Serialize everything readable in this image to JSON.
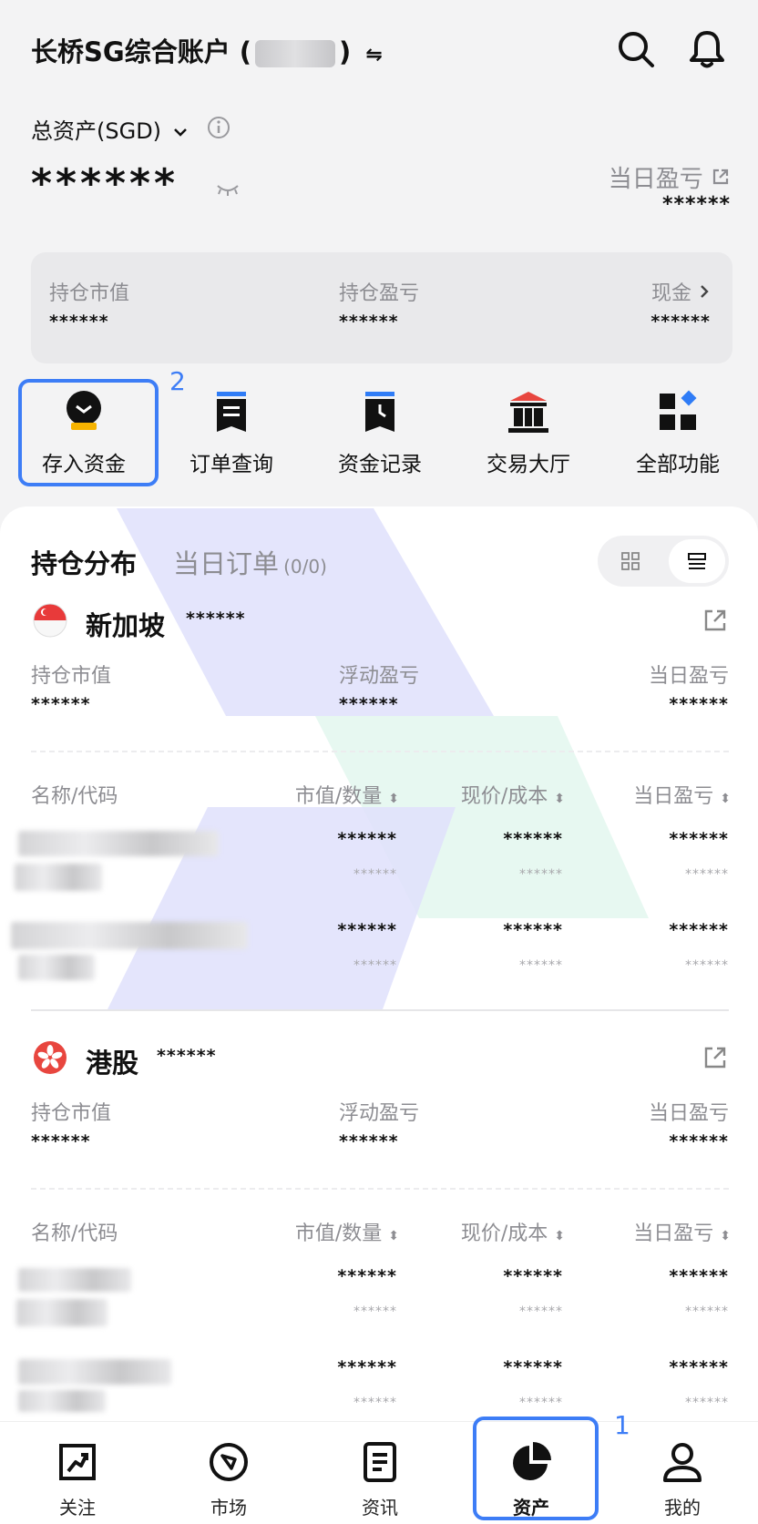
{
  "header": {
    "title_prefix": "长桥SG综合账户 (",
    "title_suffix": ")",
    "swap_glyph": "⇋",
    "search_icon": "search-icon",
    "bell_icon": "bell-icon"
  },
  "summary": {
    "total_assets_label": "总资产(SGD)",
    "total_assets_value": "******",
    "daily_pl_label": "当日盈亏",
    "daily_pl_value": "******"
  },
  "asset_card": {
    "market_value_label": "持仓市值",
    "market_value": "******",
    "position_pl_label": "持仓盈亏",
    "position_pl": "******",
    "cash_label": "现金",
    "cash_value": "******"
  },
  "quick_actions": [
    {
      "label": "存入资金",
      "icon": "deposit-icon"
    },
    {
      "label": "订单查询",
      "icon": "order-query-icon"
    },
    {
      "label": "资金记录",
      "icon": "fund-record-icon"
    },
    {
      "label": "交易大厅",
      "icon": "trading-hall-icon"
    },
    {
      "label": "全部功能",
      "icon": "all-functions-icon"
    }
  ],
  "positions": {
    "tab_holdings": "持仓分布",
    "tab_orders": "当日订单",
    "tab_orders_count": "(0/0)",
    "markets": [
      {
        "name": "新加坡",
        "total": "******",
        "labels": {
          "market_value": "持仓市值",
          "floating_pl": "浮动盈亏",
          "daily_pl": "当日盈亏"
        },
        "values": {
          "market_value": "******",
          "floating_pl": "******",
          "daily_pl": "******"
        },
        "table_headers": {
          "name": "名称/代码",
          "value_qty": "市值/数量",
          "price_cost": "现价/成本",
          "daily_pl": "当日盈亏"
        },
        "rows": [
          {
            "v1": "******",
            "v2": "******",
            "v3": "******",
            "s1": "******",
            "s2": "******",
            "s3": "******"
          },
          {
            "v1": "******",
            "v2": "******",
            "v3": "******",
            "s1": "******",
            "s2": "******",
            "s3": "******"
          }
        ]
      },
      {
        "name": "港股",
        "total": "******",
        "labels": {
          "market_value": "持仓市值",
          "floating_pl": "浮动盈亏",
          "daily_pl": "当日盈亏"
        },
        "values": {
          "market_value": "******",
          "floating_pl": "******",
          "daily_pl": "******"
        },
        "table_headers": {
          "name": "名称/代码",
          "value_qty": "市值/数量",
          "price_cost": "现价/成本",
          "daily_pl": "当日盈亏"
        },
        "rows": [
          {
            "v1": "******",
            "v2": "******",
            "v3": "******",
            "s1": "******",
            "s2": "******",
            "s3": "******"
          },
          {
            "v1": "******",
            "v2": "******",
            "v3": "******",
            "s1": "******",
            "s2": "******",
            "s3": "******"
          }
        ]
      }
    ]
  },
  "tabbar": [
    {
      "label": "关注",
      "icon": "watchlist-icon"
    },
    {
      "label": "市场",
      "icon": "market-icon"
    },
    {
      "label": "资讯",
      "icon": "news-icon"
    },
    {
      "label": "资产",
      "icon": "assets-icon"
    },
    {
      "label": "我的",
      "icon": "profile-icon"
    }
  ],
  "annotations": {
    "badge_1": "1",
    "badge_2": "2",
    "accent_color": "#3d7df6"
  }
}
